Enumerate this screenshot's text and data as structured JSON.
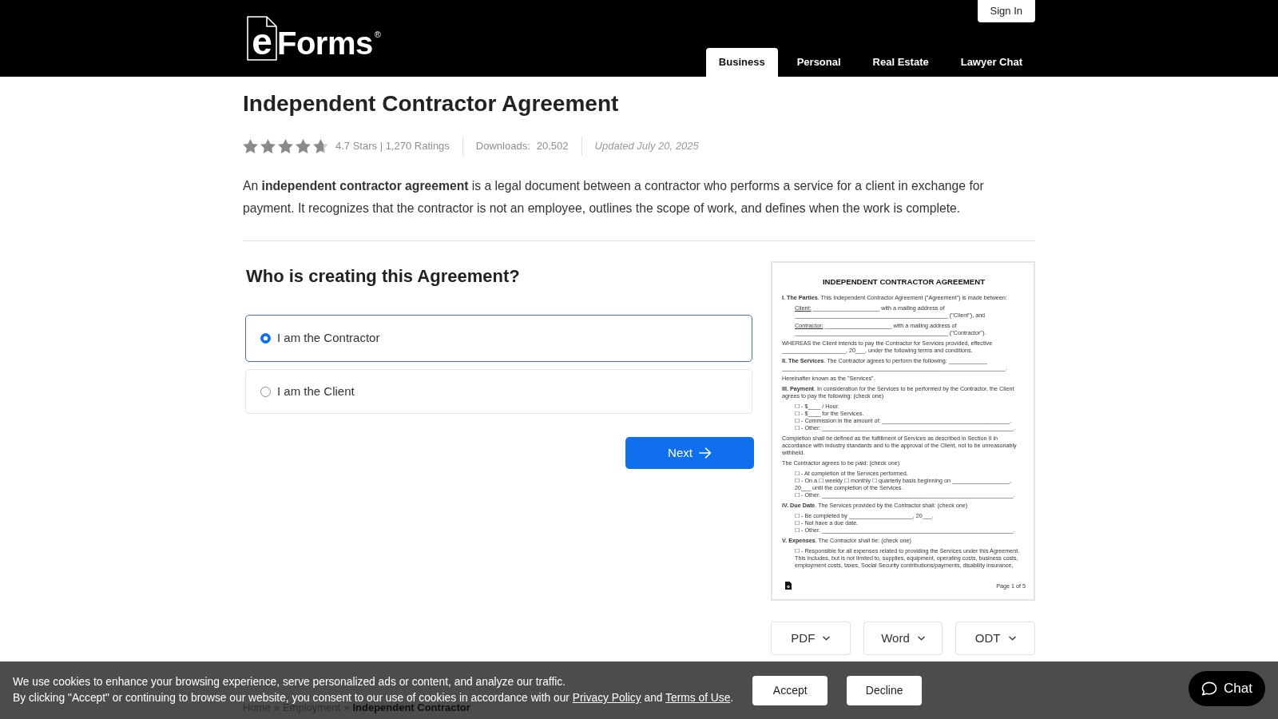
{
  "header": {
    "logo": {
      "letter": "e",
      "word": "Forms",
      "mark": "®"
    },
    "sign_in": "Sign In",
    "tabs": [
      {
        "label": "Business",
        "selected": true
      },
      {
        "label": "Personal",
        "selected": false
      },
      {
        "label": "Real Estate",
        "selected": false
      },
      {
        "label": "Lawyer Chat",
        "selected": false
      }
    ]
  },
  "title": "Independent Contractor Agreement",
  "rating": {
    "stars": 4.7,
    "summary": "4.7 Stars | 1,270 Ratings"
  },
  "downloads": {
    "label": "Downloads:",
    "value": "20,502"
  },
  "updated": "Updated July 20, 2025",
  "description": "An **independent contractor agreement** is a legal document between a contractor who performs a service for a client in exchange for payment. It recognizes that the contractor is not an employee, outlines the scope of work, and defines when the work is complete.",
  "question": {
    "heading": "Who is creating this Agreement?",
    "options": [
      {
        "label": "I am the Contractor",
        "selected": true
      },
      {
        "label": "I am the Client",
        "selected": false
      }
    ],
    "next_button": "Next"
  },
  "document_preview": {
    "title": "INDEPENDENT CONTRACTOR AGREEMENT",
    "blocks": [
      {
        "kind": "para",
        "text": "**I. The Parties**. This Independent Contractor Agreement (\"Agreement\") is made between:"
      },
      {
        "kind": "list",
        "items": [
          {
            "label": "Client:",
            "text": "_____________________ with a mailing address of"
          },
          {
            "text": "________________________________________________ (\"Client\"), and"
          }
        ]
      },
      {
        "kind": "list",
        "items": [
          {
            "label": "Contractor:",
            "text": "_____________________ with a mailing address of"
          },
          {
            "text": "________________________________________________ (\"Contractor\")."
          }
        ]
      },
      {
        "kind": "para",
        "text": "WHEREAS the Client intends to pay the Contractor for Services provided, effective ____________________, 20___, under the following terms and conditions."
      },
      {
        "kind": "para",
        "text": "**II. The Services**. The Contractor agrees to perform the following: ____________ ______________________________________________________________________."
      },
      {
        "kind": "para",
        "text": "Hereinafter known as the \"Services\"."
      },
      {
        "kind": "para",
        "text": "**III. Payment**. In consideration for the Services to be performed by the Contractor, the Client agrees to pay the following: (check one)"
      },
      {
        "kind": "list",
        "items": [
          {
            "text": "☐ - $____ / Hour."
          },
          {
            "text": "☐ - $____ for the Services."
          },
          {
            "text": "☐ - Commission in the amount of: ________________________________________."
          },
          {
            "text": "☐ - Other: ____________________________________________________________."
          }
        ]
      },
      {
        "kind": "para",
        "text": "Completion shall be defined as the fulfillment of Services as described in Section II in accordance with industry standards and to the approval of the Client, not to be unreasonably withheld."
      },
      {
        "kind": "para",
        "text": "The Contractor agrees to be paid: (check one)"
      },
      {
        "kind": "list",
        "items": [
          {
            "text": "☐ - At completion of the Services performed."
          },
          {
            "text": "☐ - On a ☐ weekly ☐ monthly ☐ quarterly basis beginning on __________________, 20___ until the completion of the Services."
          },
          {
            "text": "☐ - Other. ____________________________________________________________."
          }
        ]
      },
      {
        "kind": "para",
        "text": "**IV. Due Date**. The Services provided by the Contractor shall: (check one)"
      },
      {
        "kind": "list",
        "items": [
          {
            "text": "☐ - Be completed by ____________________, 20___."
          },
          {
            "text": "☐ - Not have a due date."
          },
          {
            "text": "☐ - Other. ____________________________________________________________."
          }
        ]
      },
      {
        "kind": "para",
        "text": "**V. Expenses**. The Contractor shall be: (check one)"
      },
      {
        "kind": "list",
        "items": [
          {
            "text": "☐ - Responsible for all expenses related to providing the Services under this Agreement. This includes, but is not limited to, supplies, equipment, operating costs, business costs, employment costs, taxes, Social Security contributions/payments, disability insurance,"
          }
        ]
      }
    ],
    "page_label": "Page 1 of 5"
  },
  "formats": [
    "PDF",
    "Word",
    "ODT"
  ],
  "breadcrumb": [
    {
      "kind": "link",
      "text": "Home"
    },
    {
      "kind": "separator",
      "text": "»"
    },
    {
      "kind": "link",
      "text": "Employment"
    },
    {
      "kind": "separator",
      "text": "»"
    },
    {
      "kind": "current",
      "text": "Independent Contractor"
    }
  ],
  "cookie_banner": {
    "notice": "We use cookies to enhance your browsing experience, serve personalized ads or content, and analyze our traffic.",
    "consent_parts": [
      {
        "kind": "text",
        "text": "By clicking \"Accept\" or continuing to browse our website, you consent to our use of cookies in accordance with our "
      },
      {
        "kind": "link",
        "text": "Privacy Policy"
      },
      {
        "kind": "text",
        "text": " and "
      },
      {
        "kind": "link",
        "text": "Terms of Use"
      },
      {
        "kind": "text",
        "text": "."
      }
    ],
    "buttons": [
      "Accept",
      "Decline"
    ]
  },
  "chat_button": "Chat"
}
